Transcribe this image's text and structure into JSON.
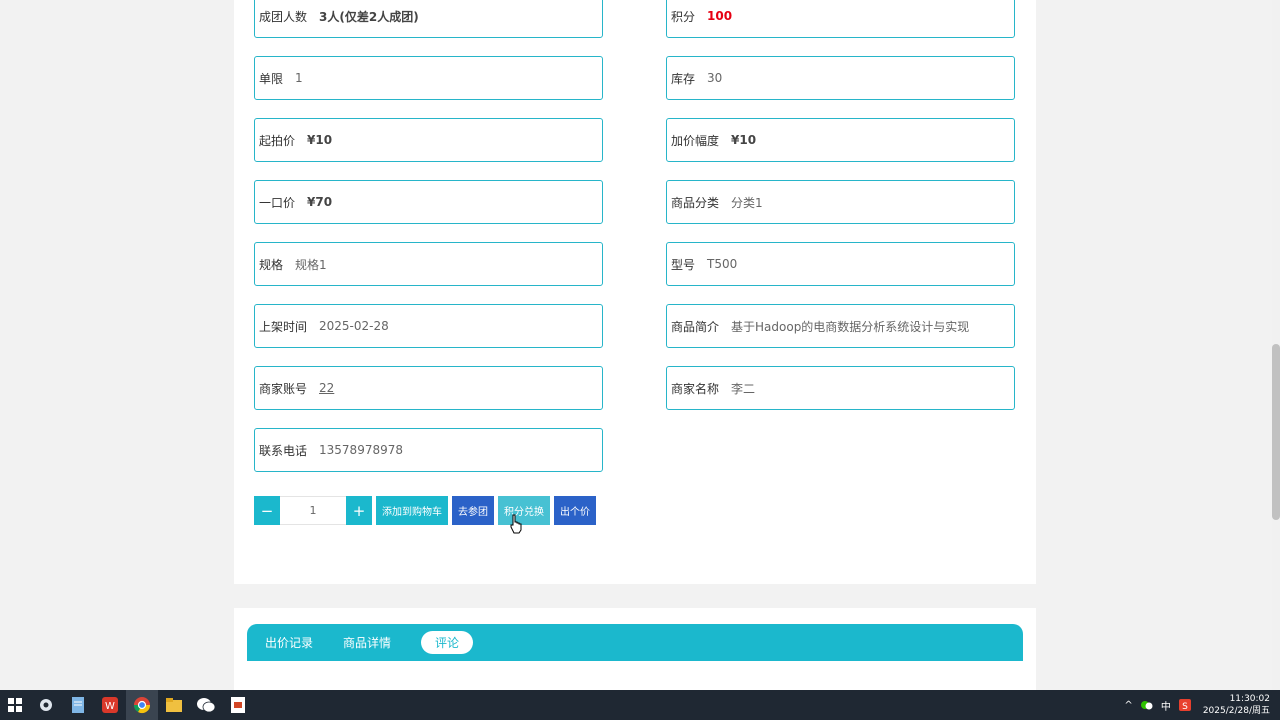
{
  "fields_left": [
    {
      "label": "成团人数",
      "value": "3人(仅差2人成团)",
      "style": "bold"
    },
    {
      "label": "单限",
      "value": "1",
      "style": "normal"
    },
    {
      "label": "起拍价",
      "value": "¥10",
      "style": "bold"
    },
    {
      "label": "一口价",
      "value": "¥70",
      "style": "bold"
    },
    {
      "label": "规格",
      "value": "规格1",
      "style": "normal"
    },
    {
      "label": "上架时间",
      "value": "2025-02-28",
      "style": "normal"
    },
    {
      "label": "商家账号",
      "value": "22",
      "style": "link"
    },
    {
      "label": "联系电话",
      "value": "13578978978",
      "style": "normal"
    }
  ],
  "fields_right": [
    {
      "label": "积分",
      "value": "100",
      "style": "red"
    },
    {
      "label": "库存",
      "value": "30",
      "style": "normal"
    },
    {
      "label": "加价幅度",
      "value": "¥10",
      "style": "bold"
    },
    {
      "label": "商品分类",
      "value": "分类1",
      "style": "normal"
    },
    {
      "label": "型号",
      "value": "T500",
      "style": "normal"
    },
    {
      "label": "商品简介",
      "value": "基于Hadoop的电商数据分析系统设计与实现",
      "style": "normal"
    },
    {
      "label": "商家名称",
      "value": "李二",
      "style": "normal"
    }
  ],
  "actions": {
    "minus": "−",
    "plus": "+",
    "quantity": "1",
    "add_cart": "添加到购物车",
    "join_group": "去参团",
    "points_exchange": "积分兑换",
    "bid": "出个价"
  },
  "tabs": [
    {
      "label": "出价记录",
      "active": false
    },
    {
      "label": "商品详情",
      "active": false
    },
    {
      "label": "评论",
      "active": true
    }
  ],
  "colors": {
    "accent": "#1bb8cd",
    "dark_blue": "#2b62c8",
    "light_cyan": "#47c1d3",
    "red": "#e60012"
  },
  "taskbar": {
    "ime": "中",
    "time": "11:30:02",
    "date": "2025/2/28/周五"
  }
}
